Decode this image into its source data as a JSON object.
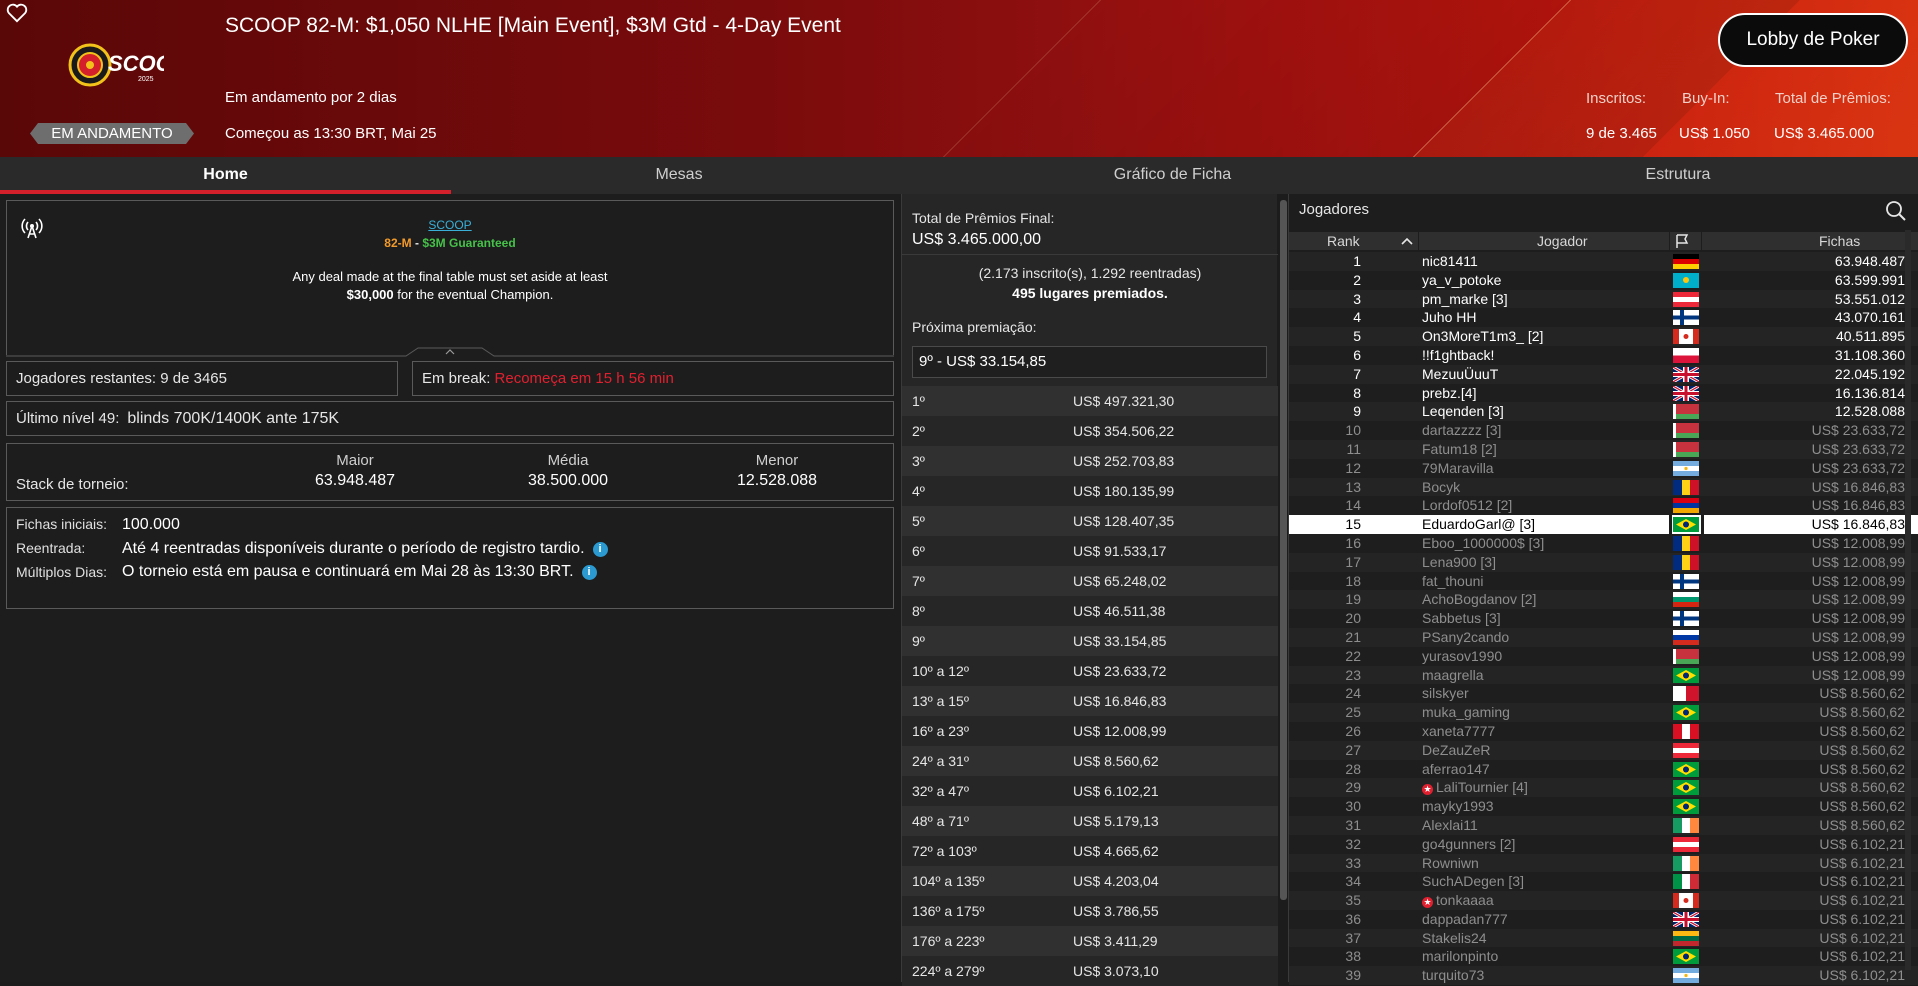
{
  "header": {
    "title": "SCOOP 82-M: $1,050 NLHE [Main Event], $3M Gtd - 4-Day Event",
    "running_for": "Em andamento por 2 dias",
    "started": "Começou as 13:30 BRT, Mai 25",
    "status": "EM ANDAMENTO",
    "lobby_button": "Lobby de Poker",
    "stats": [
      {
        "label": "Inscritos:",
        "value": "9 de 3.465"
      },
      {
        "label": "Buy-In:",
        "value": "US$ 1.050"
      },
      {
        "label": "Total de Prêmios:",
        "value": "US$ 3.465.000"
      }
    ]
  },
  "tabs": [
    {
      "label": "Home",
      "active": true
    },
    {
      "label": "Mesas",
      "active": false
    },
    {
      "label": "Gráfico de Ficha",
      "active": false
    },
    {
      "label": "Estrutura",
      "active": false
    }
  ],
  "info": {
    "link": "SCOOP",
    "event": "82-M",
    "dash": " - ",
    "guarantee": "$3M Guaranteed",
    "deal_line1": "Any deal made at the final table must set aside at least",
    "deal_amount": "$30,000",
    "deal_line2_rest": " for the eventual Champion."
  },
  "remaining": {
    "label": "Jogadores restantes:",
    "value": "9 de 3465"
  },
  "break": {
    "label": "Em break:",
    "value": "Recomeça em 15 h 56 min"
  },
  "level": {
    "label": "Último nível 49:",
    "value": "blinds 700K/1400K ante 175K"
  },
  "stack": {
    "label": "Stack de torneio:",
    "cols": [
      {
        "header": "Maior",
        "value": "63.948.487"
      },
      {
        "header": "Média",
        "value": "38.500.000"
      },
      {
        "header": "Menor",
        "value": "12.528.088"
      }
    ]
  },
  "details": {
    "initial_label": "Fichas iniciais:",
    "initial_value": "100.000",
    "reentry_label": "Reentrada:",
    "reentry_value": "Até 4 reentradas disponíveis durante o período de registro tardio.",
    "multi_label": "Múltiplos Dias:",
    "multi_value": "O torneio está em pausa e continuará em Mai 28 às 13:30 BRT."
  },
  "prizes": {
    "total_label": "Total de Prêmios Final:",
    "total_value": "US$ 3.465.000,00",
    "entrants": "(2.173 inscrito(s), 1.292 reentradas)",
    "places": "495 lugares premiados.",
    "next_label": "Próxima premiação:",
    "next_value": "9º - US$ 33.154,85",
    "rows": [
      {
        "place": "1º",
        "amount": "US$ 497.321,30"
      },
      {
        "place": "2º",
        "amount": "US$ 354.506,22"
      },
      {
        "place": "3º",
        "amount": "US$ 252.703,83"
      },
      {
        "place": "4º",
        "amount": "US$ 180.135,99"
      },
      {
        "place": "5º",
        "amount": "US$ 128.407,35"
      },
      {
        "place": "6º",
        "amount": "US$ 91.533,17"
      },
      {
        "place": "7º",
        "amount": "US$ 65.248,02"
      },
      {
        "place": "8º",
        "amount": "US$ 46.511,38"
      },
      {
        "place": "9º",
        "amount": "US$ 33.154,85"
      },
      {
        "place": "10º a 12º",
        "amount": "US$ 23.633,72"
      },
      {
        "place": "13º a 15º",
        "amount": "US$ 16.846,83"
      },
      {
        "place": "16º a 23º",
        "amount": "US$ 12.008,99"
      },
      {
        "place": "24º a 31º",
        "amount": "US$ 8.560,62"
      },
      {
        "place": "32º a 47º",
        "amount": "US$ 6.102,21"
      },
      {
        "place": "48º a 71º",
        "amount": "US$ 5.179,13"
      },
      {
        "place": "72º a 103º",
        "amount": "US$ 4.665,62"
      },
      {
        "place": "104º a 135º",
        "amount": "US$ 4.203,04"
      },
      {
        "place": "136º a 175º",
        "amount": "US$ 3.786,55"
      },
      {
        "place": "176º a 223º",
        "amount": "US$ 3.411,29"
      },
      {
        "place": "224º a 279º",
        "amount": "US$ 3.073,10"
      }
    ]
  },
  "players": {
    "title": "Jogadores",
    "headers": {
      "rank": "Rank",
      "player": "Jogador",
      "chips": "Fichas"
    },
    "rows": [
      {
        "rank": "1",
        "name": "nic81411",
        "chips": "63.948.487",
        "flag": "de",
        "state": "active"
      },
      {
        "rank": "2",
        "name": "ya_v_potoke",
        "chips": "63.599.991",
        "flag": "kz",
        "state": "active"
      },
      {
        "rank": "3",
        "name": "pm_marke [3]",
        "chips": "53.551.012",
        "flag": "at",
        "state": "active"
      },
      {
        "rank": "4",
        "name": "Juho HH",
        "chips": "43.070.161",
        "flag": "fi",
        "state": "active"
      },
      {
        "rank": "5",
        "name": "On3MoreT1m3_ [2]",
        "chips": "40.511.895",
        "flag": "ca",
        "state": "active"
      },
      {
        "rank": "6",
        "name": "!!f1ghtback!",
        "chips": "31.108.360",
        "flag": "pl",
        "state": "active"
      },
      {
        "rank": "7",
        "name": "MezuuÜuuT",
        "chips": "22.045.192",
        "flag": "gb",
        "state": "active"
      },
      {
        "rank": "8",
        "name": "prebz.[4]",
        "chips": "16.136.814",
        "flag": "gb",
        "state": "active"
      },
      {
        "rank": "9",
        "name": "Leqenden [3]",
        "chips": "12.528.088",
        "flag": "by",
        "state": "active"
      },
      {
        "rank": "10",
        "name": "dartazzzz [3]",
        "chips": "US$ 23.633,72",
        "flag": "by",
        "state": "elim"
      },
      {
        "rank": "11",
        "name": "Fatum18 [2]",
        "chips": "US$ 23.633,72",
        "flag": "by",
        "state": "elim"
      },
      {
        "rank": "12",
        "name": "79Maravilla",
        "chips": "US$ 23.633,72",
        "flag": "ar",
        "state": "elim"
      },
      {
        "rank": "13",
        "name": "Bocyk",
        "chips": "US$ 16.846,83",
        "flag": "ro",
        "state": "elim"
      },
      {
        "rank": "14",
        "name": "Lordof0512 [2]",
        "chips": "US$ 16.846,83",
        "flag": "am",
        "state": "elim"
      },
      {
        "rank": "15",
        "name": "EduardoGarl@ [3]",
        "chips": "US$ 16.846,83",
        "flag": "br",
        "state": "hl"
      },
      {
        "rank": "16",
        "name": "Eboo_1000000$ [3]",
        "chips": "US$ 12.008,99",
        "flag": "ro",
        "state": "elim"
      },
      {
        "rank": "17",
        "name": "Lena900 [3]",
        "chips": "US$ 12.008,99",
        "flag": "ro",
        "state": "elim"
      },
      {
        "rank": "18",
        "name": "fat_thouni",
        "chips": "US$ 12.008,99",
        "flag": "fi",
        "state": "elim"
      },
      {
        "rank": "19",
        "name": "AchoBogdanov [2]",
        "chips": "US$ 12.008,99",
        "flag": "bg",
        "state": "elim"
      },
      {
        "rank": "20",
        "name": "Sabbetus [3]",
        "chips": "US$ 12.008,99",
        "flag": "fi",
        "state": "elim"
      },
      {
        "rank": "21",
        "name": "PSany2cando",
        "chips": "US$ 12.008,99",
        "flag": "ru",
        "state": "elim"
      },
      {
        "rank": "22",
        "name": "yurasov1990",
        "chips": "US$ 12.008,99",
        "flag": "by",
        "state": "elim"
      },
      {
        "rank": "23",
        "name": "maagrella",
        "chips": "US$ 12.008,99",
        "flag": "br",
        "state": "elim"
      },
      {
        "rank": "24",
        "name": "silskyer",
        "chips": "US$ 8.560,62",
        "flag": "mt",
        "state": "elim"
      },
      {
        "rank": "25",
        "name": "muka_gaming",
        "chips": "US$ 8.560,62",
        "flag": "br",
        "state": "elim"
      },
      {
        "rank": "26",
        "name": "xaneta7777",
        "chips": "US$ 8.560,62",
        "flag": "pe",
        "state": "elim"
      },
      {
        "rank": "27",
        "name": "DeZauZeR",
        "chips": "US$ 8.560,62",
        "flag": "at",
        "state": "elim"
      },
      {
        "rank": "28",
        "name": "aferrao147",
        "chips": "US$ 8.560,62",
        "flag": "br",
        "state": "elim"
      },
      {
        "rank": "29",
        "name": "LaliTournier [4]",
        "chips": "US$ 8.560,62",
        "flag": "br",
        "state": "elim",
        "star": true
      },
      {
        "rank": "30",
        "name": "mayky1993",
        "chips": "US$ 8.560,62",
        "flag": "br",
        "state": "elim"
      },
      {
        "rank": "31",
        "name": "Alexlai11",
        "chips": "US$ 8.560,62",
        "flag": "ie",
        "state": "elim"
      },
      {
        "rank": "32",
        "name": "go4gunners [2]",
        "chips": "US$ 6.102,21",
        "flag": "at",
        "state": "elim"
      },
      {
        "rank": "33",
        "name": "Rowniwn",
        "chips": "US$ 6.102,21",
        "flag": "ie",
        "state": "elim"
      },
      {
        "rank": "34",
        "name": "SuchADegen [3]",
        "chips": "US$ 6.102,21",
        "flag": "it",
        "state": "elim"
      },
      {
        "rank": "35",
        "name": "tonkaaaa",
        "chips": "US$ 6.102,21",
        "flag": "ca",
        "state": "elim",
        "star": true
      },
      {
        "rank": "36",
        "name": "dappadan777",
        "chips": "US$ 6.102,21",
        "flag": "gb",
        "state": "elim"
      },
      {
        "rank": "37",
        "name": "Stakelis24",
        "chips": "US$ 6.102,21",
        "flag": "lt",
        "state": "elim"
      },
      {
        "rank": "38",
        "name": "marilonpinto",
        "chips": "US$ 6.102,21",
        "flag": "br",
        "state": "elim"
      },
      {
        "rank": "39",
        "name": "turquito73",
        "chips": "US$ 6.102,21",
        "flag": "ar",
        "state": "elim"
      }
    ]
  },
  "icons": {
    "heart": "heart-icon",
    "antenna": "antenna-icon",
    "search": "search-icon",
    "flag": "flag-icon",
    "sort": "sort-up-icon",
    "info": "info-icon"
  },
  "colors": {
    "accent": "#d3202b",
    "break_red": "#e0202f",
    "link": "#3ab0d8",
    "event_orange": "#f29a2a",
    "guarantee_green": "#46c24a"
  }
}
